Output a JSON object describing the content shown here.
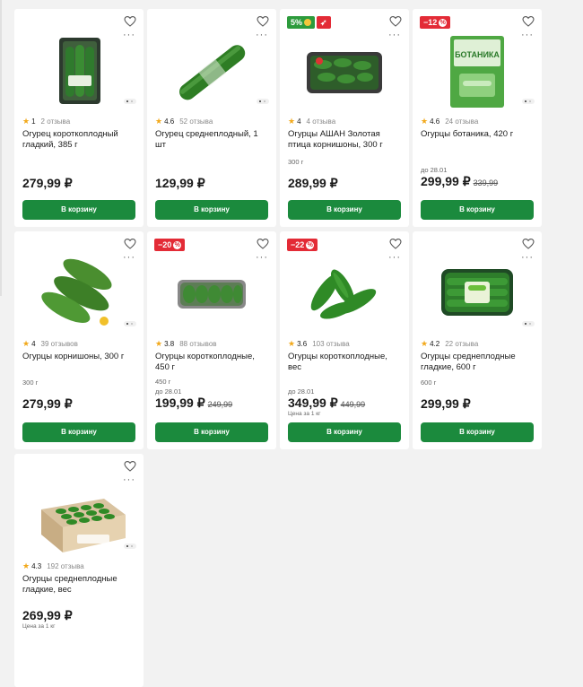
{
  "products": [
    {
      "badges": [],
      "rating": "1",
      "reviews": "2 отзыва",
      "name": "Огурец короткоплодный гладкий, 385 г",
      "weight": "",
      "until": "",
      "price": "279,99 ₽",
      "old_price": "",
      "unit_price": "",
      "button": "В корзину",
      "image": "cucumbers-tray-icon"
    },
    {
      "badges": [],
      "rating": "4.6",
      "reviews": "52 отзыва",
      "name": "Огурец среднеплодный, 1 шт",
      "weight": "",
      "until": "",
      "price": "129,99 ₽",
      "old_price": "",
      "unit_price": "",
      "button": "В корзину",
      "image": "cucumber-wrapped-icon"
    },
    {
      "badges": [
        {
          "text": "5%",
          "type": "green-coin"
        },
        {
          "text": "",
          "type": "red-logo"
        }
      ],
      "rating": "4",
      "reviews": "4 отзыва",
      "name": "Огурцы АШАН Золотая птица корнишоны, 300 г",
      "weight": "300 г",
      "until": "",
      "price": "289,99 ₽",
      "old_price": "",
      "unit_price": "",
      "button": "В корзину",
      "image": "cornichons-pack-icon"
    },
    {
      "badges": [
        {
          "text": "−12",
          "type": "red-pct"
        }
      ],
      "rating": "4.6",
      "reviews": "24 отзыва",
      "name": "Огурцы ботаника, 420 г",
      "weight": "",
      "until": "до 28.01",
      "price": "299,99 ₽",
      "old_price": "339,99",
      "unit_price": "",
      "button": "В корзину",
      "image": "botanika-bag-icon",
      "bag_text": "БОТАНИКА"
    },
    {
      "badges": [],
      "rating": "4",
      "reviews": "39 отзывов",
      "name": "Огурцы корнишоны, 300 г",
      "weight": "300 г",
      "until": "",
      "price": "279,99 ₽",
      "old_price": "",
      "unit_price": "",
      "button": "В корзину",
      "image": "cornichons-loose-icon"
    },
    {
      "badges": [
        {
          "text": "−20",
          "type": "red-pct"
        }
      ],
      "rating": "3.8",
      "reviews": "88 отзывов",
      "name": "Огурцы короткоплодные, 450 г",
      "weight": "450 г",
      "until": "до 28.01",
      "price": "199,99 ₽",
      "old_price": "249,99",
      "unit_price": "",
      "button": "В корзину",
      "image": "cucumbers-tray-flat-icon"
    },
    {
      "badges": [
        {
          "text": "−22",
          "type": "red-pct"
        }
      ],
      "rating": "3.6",
      "reviews": "103 отзыва",
      "name": "Огурцы короткоплодные, вес",
      "weight": "",
      "until": "до 28.01",
      "price": "349,99 ₽",
      "old_price": "449,99",
      "unit_price": "Цена за 1 кг",
      "button": "В корзину",
      "image": "cucumbers-loose-icon"
    },
    {
      "badges": [],
      "rating": "4.2",
      "reviews": "22 отзыва",
      "name": "Огурцы среднеплодные гладкие, 600 г",
      "weight": "600 г",
      "until": "",
      "price": "299,99 ₽",
      "old_price": "",
      "unit_price": "",
      "button": "В корзину",
      "image": "cucumbers-wrapped-pack-icon"
    },
    {
      "badges": [],
      "rating": "4.3",
      "reviews": "192 отзыва",
      "name": "Огурцы среднеплодные гладкие, вес",
      "weight": "",
      "until": "",
      "price": "269,99 ₽",
      "old_price": "",
      "unit_price": "Цена за 1 кг",
      "button": "В корзину",
      "image": "cucumbers-box-icon"
    }
  ],
  "colors": {
    "accent": "#1b8a3d",
    "sale": "#e32b36",
    "star": "#f2a91c"
  }
}
